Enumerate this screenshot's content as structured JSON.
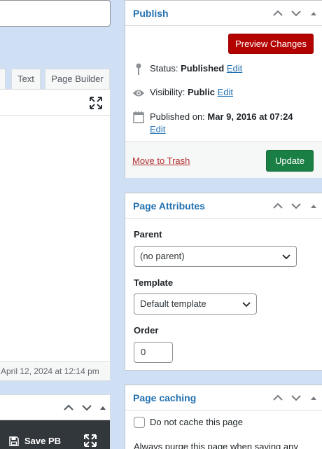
{
  "editor": {
    "tabs": [
      {
        "label": ""
      },
      {
        "label": "Text"
      },
      {
        "label": "Page Builder"
      }
    ],
    "status_text": "April 12, 2024 at 12:14 pm"
  },
  "page_builder": {
    "save_label": "Save PB"
  },
  "publish": {
    "title": "Publish",
    "preview_label": "Preview Changes",
    "status_label": "Status:",
    "status_value": "Published",
    "visibility_label": "Visibility:",
    "visibility_value": "Public",
    "published_label": "Published on:",
    "published_value": "Mar 9, 2016 at 07:24",
    "edit_label": "Edit",
    "trash_label": "Move to Trash",
    "update_label": "Update"
  },
  "page_attributes": {
    "title": "Page Attributes",
    "parent_label": "Parent",
    "parent_value": "(no parent)",
    "template_label": "Template",
    "template_value": "Default template",
    "order_label": "Order",
    "order_value": "0"
  },
  "page_caching": {
    "title": "Page caching",
    "nocache_label": "Do not cache this page",
    "purge_text": "Always purge this page when saving any"
  },
  "colors": {
    "accent": "#2271b1",
    "preview_button": "#b30000",
    "update_button": "#1a7f44",
    "trash_link": "#b32d2e",
    "background": "#cfe0f4"
  }
}
